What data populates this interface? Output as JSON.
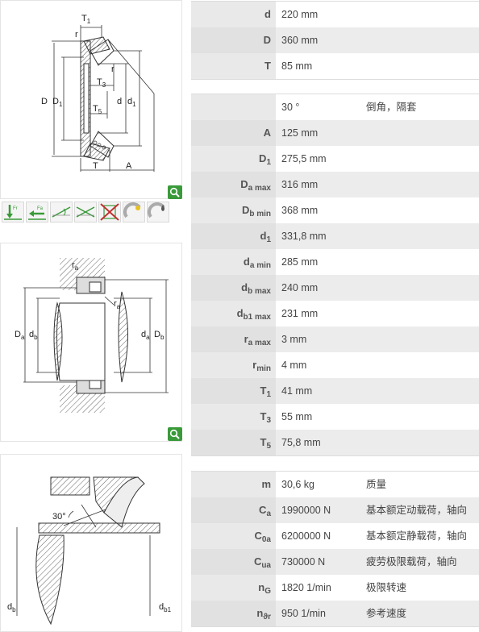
{
  "diagram1": {
    "T1": "T",
    "T1s": "1",
    "r": "r",
    "r2": "r",
    "T3": "T",
    "T3s": "3",
    "T5": "T",
    "T5s": "5",
    "D": "D",
    "D1": "D",
    "D1s": "1",
    "d": "d",
    "d1": "d",
    "d1s": "1",
    "T": "T",
    "A": "A"
  },
  "diagram2": {
    "ra1": "r",
    "ra1s": "a",
    "ra2": "r",
    "ra2s": "a",
    "Da": "D",
    "Das": "a",
    "db": "d",
    "dbs": "b",
    "da": "d",
    "das": "a",
    "Db": "D",
    "Dbs": "b"
  },
  "diagram3": {
    "angle": "30°",
    "db": "d",
    "dbs": "b",
    "db1": "d",
    "db1s": "b1"
  },
  "icons": [
    "radial-load-icon",
    "axial-load-icon",
    "misalignment-icon",
    "angular-misalignment-icon",
    "not-separable-icon",
    "lubrication-icon",
    "oil-lubrication-icon"
  ],
  "table1": [
    {
      "sym": "d",
      "sub": "",
      "val": "220  mm"
    },
    {
      "sym": "D",
      "sub": "",
      "val": "360  mm"
    },
    {
      "sym": "T",
      "sub": "",
      "val": "85  mm"
    }
  ],
  "table2": [
    {
      "sym": "",
      "sub": "",
      "val": "30  °",
      "desc": "倒角，隔套"
    },
    {
      "sym": "A",
      "sub": "",
      "val": "125  mm",
      "desc": ""
    },
    {
      "sym": "D",
      "sub": "1",
      "val": "275,5  mm",
      "desc": ""
    },
    {
      "sym": "D",
      "sub": "a max",
      "val": "316  mm",
      "desc": ""
    },
    {
      "sym": "D",
      "sub": "b min",
      "val": "368  mm",
      "desc": ""
    },
    {
      "sym": "d",
      "sub": "1",
      "val": "331,8  mm",
      "desc": ""
    },
    {
      "sym": "d",
      "sub": "a min",
      "val": "285  mm",
      "desc": ""
    },
    {
      "sym": "d",
      "sub": "b max",
      "val": "240  mm",
      "desc": ""
    },
    {
      "sym": "d",
      "sub": "b1 max",
      "val": "231  mm",
      "desc": ""
    },
    {
      "sym": "r",
      "sub": "a max",
      "val": "3  mm",
      "desc": ""
    },
    {
      "sym": "r",
      "sub": "min",
      "val": "4  mm",
      "desc": ""
    },
    {
      "sym": "T",
      "sub": "1",
      "val": "41  mm",
      "desc": ""
    },
    {
      "sym": "T",
      "sub": "3",
      "val": "55  mm",
      "desc": ""
    },
    {
      "sym": "T",
      "sub": "5",
      "val": "75,8  mm",
      "desc": ""
    }
  ],
  "table3": [
    {
      "sym": "m",
      "sub": "",
      "val": "30,6  kg",
      "desc": "质量"
    },
    {
      "sym": "C",
      "sub": "a",
      "val": "1990000  N",
      "desc": "基本额定动载荷，轴向"
    },
    {
      "sym": "C",
      "sub": "0a",
      "val": "6200000  N",
      "desc": "基本额定静载荷，轴向"
    },
    {
      "sym": "C",
      "sub": "ua",
      "val": "730000  N",
      "desc": "疲劳极限载荷，轴向"
    },
    {
      "sym": "n",
      "sub": "G",
      "val": "1820  1/min",
      "desc": "极限转速"
    },
    {
      "sym": "n",
      "sub": "ϑr",
      "val": "950  1/min",
      "desc": "参考速度"
    }
  ]
}
